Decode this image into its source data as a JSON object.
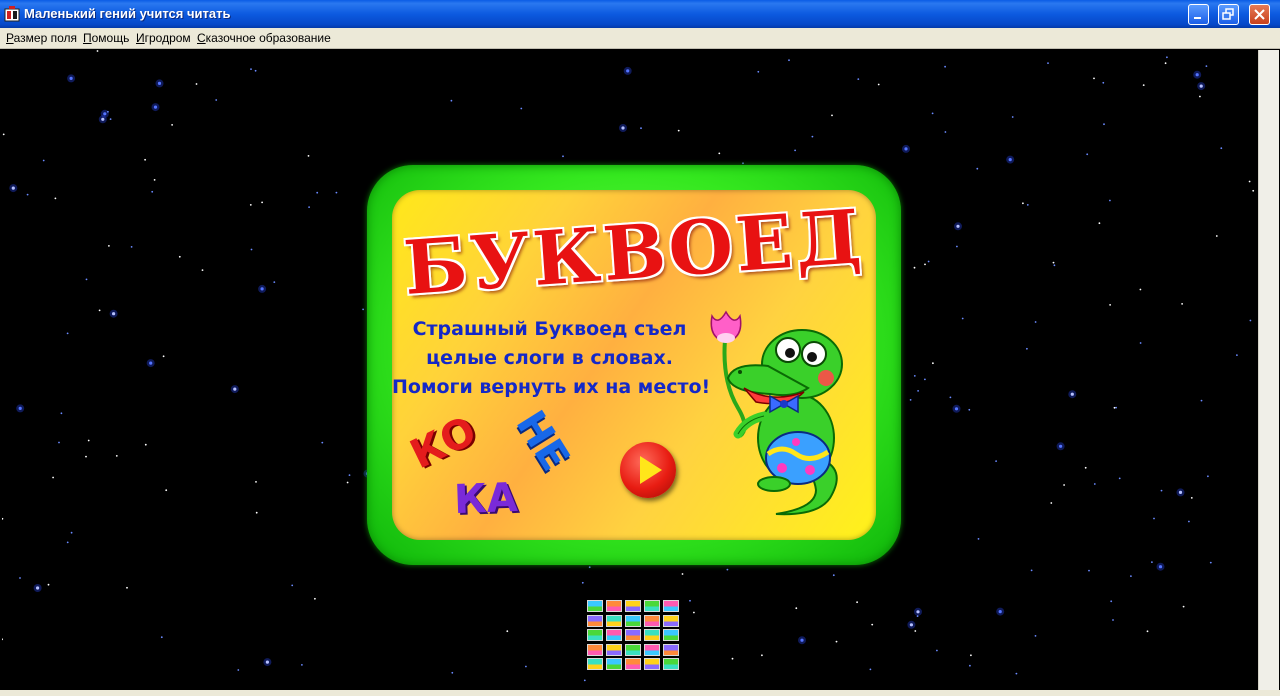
{
  "window": {
    "title": "Маленький гений учится читать",
    "controls": [
      "minimize",
      "restore",
      "close"
    ]
  },
  "menu": {
    "items": [
      "Размер поля",
      "Помощь",
      "Игродром",
      "Сказочное образование"
    ]
  },
  "game": {
    "title": "БУКВОЕД",
    "description": [
      "Страшный Буквоед съел",
      "целые слоги в словах.",
      "Помоги вернуть их на место!"
    ],
    "syllables": [
      "КО",
      "НЕ",
      "КА"
    ],
    "play_button_icon": "play-icon"
  },
  "levels": {
    "rows": 5,
    "columns": 5
  },
  "colors": {
    "titlebar": "#0c5ae0",
    "frame": "#35e81f",
    "panel": "#ffd23a",
    "title_text": "#e81212",
    "description_text": "#1428c8"
  }
}
